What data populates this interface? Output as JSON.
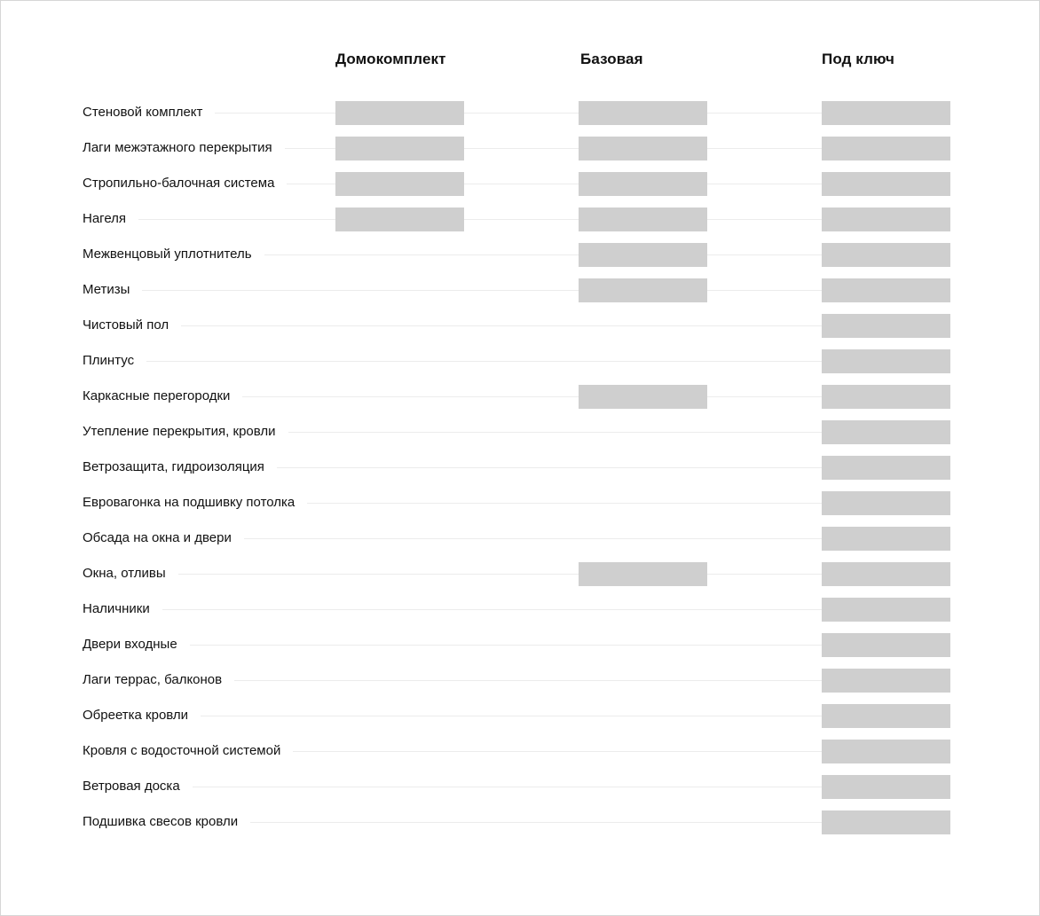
{
  "columns": [
    "Домокомплект",
    "Базовая",
    "Под ключ"
  ],
  "rows": [
    {
      "label": "Стеновой комплект",
      "included": [
        true,
        true,
        true
      ]
    },
    {
      "label": "Лаги межэтажного перекрытия",
      "included": [
        true,
        true,
        true
      ]
    },
    {
      "label": "Стропильно-балочная система",
      "included": [
        true,
        true,
        true
      ]
    },
    {
      "label": "Нагеля",
      "included": [
        true,
        true,
        true
      ]
    },
    {
      "label": "Межвенцовый уплотнитель",
      "included": [
        false,
        true,
        true
      ]
    },
    {
      "label": "Метизы",
      "included": [
        false,
        true,
        true
      ]
    },
    {
      "label": "Чистовый пол",
      "included": [
        false,
        false,
        true
      ]
    },
    {
      "label": "Плинтус",
      "included": [
        false,
        false,
        true
      ]
    },
    {
      "label": "Каркасные перегородки",
      "included": [
        false,
        true,
        true
      ]
    },
    {
      "label": "Утепление перекрытия, кровли",
      "included": [
        false,
        false,
        true
      ]
    },
    {
      "label": "Ветрозащита, гидроизоляция",
      "included": [
        false,
        false,
        true
      ]
    },
    {
      "label": "Евровагонка на подшивку потолка",
      "included": [
        false,
        false,
        true
      ]
    },
    {
      "label": "Обсада на окна и двери",
      "included": [
        false,
        false,
        true
      ]
    },
    {
      "label": "Окна, отливы",
      "included": [
        false,
        true,
        true
      ]
    },
    {
      "label": "Наличники",
      "included": [
        false,
        false,
        true
      ]
    },
    {
      "label": "Двери входные",
      "included": [
        false,
        false,
        true
      ]
    },
    {
      "label": "Лаги террас, балконов",
      "included": [
        false,
        false,
        true
      ]
    },
    {
      "label": "Обреетка кровли",
      "included": [
        false,
        false,
        true
      ]
    },
    {
      "label": "Кровля с водосточной системой",
      "included": [
        false,
        false,
        true
      ]
    },
    {
      "label": "Ветровая доска",
      "included": [
        false,
        false,
        true
      ]
    },
    {
      "label": "Подшивка свесов кровли",
      "included": [
        false,
        false,
        true
      ]
    }
  ],
  "colors": {
    "cell_fill": "#cfcfcf",
    "row_line": "#ececec",
    "text": "#111111",
    "background": "#ffffff"
  }
}
